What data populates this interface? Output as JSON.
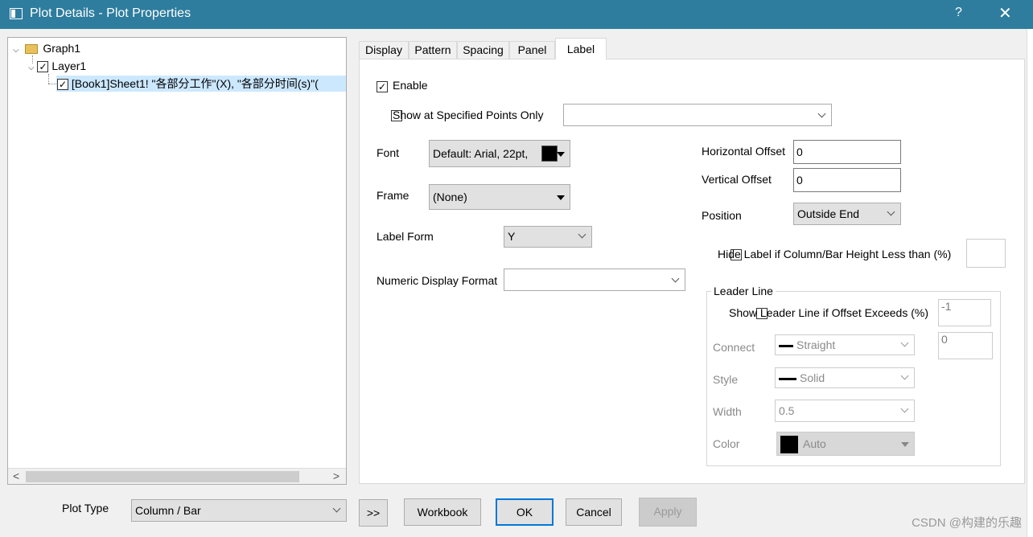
{
  "window": {
    "title": "Plot Details - Plot Properties",
    "help": "?",
    "close": "✕"
  },
  "tree": {
    "graph": "Graph1",
    "layer": "Layer1",
    "plot": "[Book1]Sheet1! \"各部分工作\"(X), \"各部分时间(s)\"("
  },
  "tabs": [
    "Display",
    "Pattern",
    "Spacing",
    "Panel",
    "Label"
  ],
  "label": {
    "enable": "Enable",
    "show_specified": "Show at Specified Points Only",
    "font_label": "Font",
    "font_value": "Default: Arial, 22pt,",
    "font_color": "#000000",
    "frame_label": "Frame",
    "frame_value": "(None)",
    "label_form_label": "Label Form",
    "label_form_value": "Y",
    "numeric_format_label": "Numeric Display Format",
    "h_offset_label": "Horizontal Offset",
    "h_offset_value": "0",
    "v_offset_label": "Vertical Offset",
    "v_offset_value": "0",
    "position_label": "Position",
    "position_value": "Outside End",
    "hide_label": "Hide Label if Column/Bar Height Less than (%)",
    "leader": {
      "title": "Leader Line",
      "show": "Show Leader Line if Offset Exceeds (%)",
      "offset_value": "-1",
      "connect_label": "Connect",
      "connect_value": "Straight",
      "connect_num": "0",
      "style_label": "Style",
      "style_value": "Solid",
      "width_label": "Width",
      "width_value": "0.5",
      "color_label": "Color",
      "color_value": "Auto",
      "color_swatch": "#000000"
    }
  },
  "footer": {
    "plot_type_label": "Plot Type",
    "plot_type_value": "Column / Bar",
    "more": ">>",
    "workbook": "Workbook",
    "ok": "OK",
    "cancel": "Cancel",
    "apply": "Apply"
  },
  "watermark": "CSDN @构建的乐趣"
}
